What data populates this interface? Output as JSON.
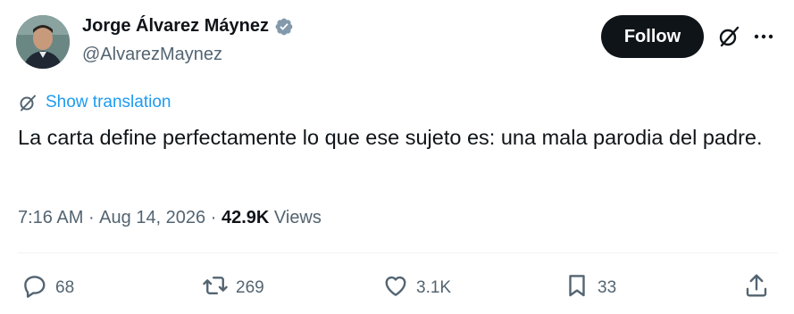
{
  "author": {
    "name": "Jorge Álvarez Máynez",
    "handle": "@AlvarezMaynez",
    "verified": true
  },
  "header": {
    "follow_label": "Follow"
  },
  "translation": {
    "label": "Show translation"
  },
  "tweet": {
    "text": "La carta define perfectamente lo que ese sujeto es: una mala parodia del padre."
  },
  "meta": {
    "time": "7:16 AM",
    "date": "Aug 14, 2026",
    "views_count": "42.9K",
    "views_label": "Views"
  },
  "actions": {
    "replies": "68",
    "reposts": "269",
    "likes": "3.1K",
    "bookmarks": "33"
  },
  "icons": {
    "verified": "verified-badge-icon",
    "grok": "grok-icon",
    "more": "more-icon",
    "translate": "translate-icon",
    "reply": "reply-icon",
    "repost": "repost-icon",
    "like": "like-icon",
    "bookmark": "bookmark-icon",
    "share": "share-icon"
  },
  "colors": {
    "text_primary": "#0f1419",
    "text_secondary": "#536471",
    "link_blue": "#1d9bf0",
    "follow_bg": "#0f1419",
    "divider": "#eff3f4"
  }
}
